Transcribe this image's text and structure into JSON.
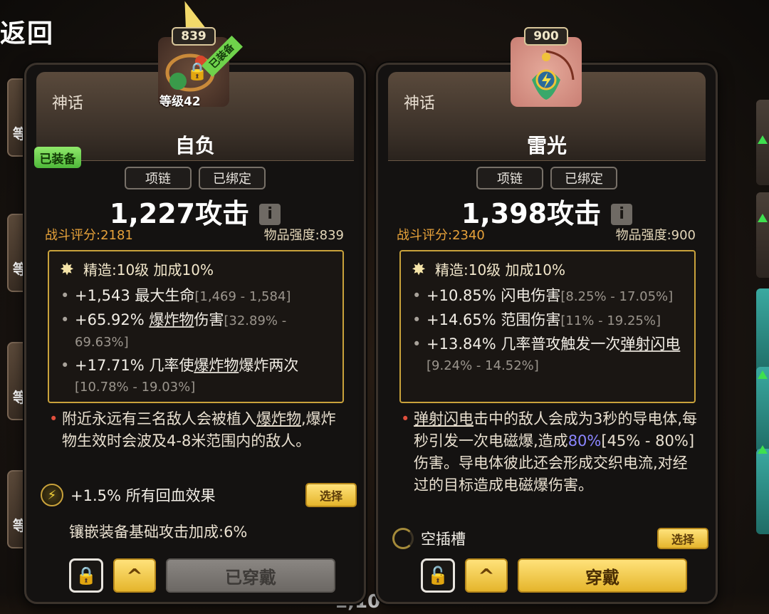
{
  "nav": {
    "back_label": "返回"
  },
  "background": {
    "bottom_text": "1,10"
  },
  "left_card": {
    "item_level": "839",
    "equipped_ribbon": "已装备",
    "thumb_level": "等级42",
    "equipped_badge": "已装备",
    "rarity": "神话",
    "name": "自负",
    "tags": [
      "项链",
      "已绑定"
    ],
    "attack": "1,227攻击",
    "combat_score": "战斗评分:2181",
    "item_power": "物品强度:839",
    "refine": "精造:10级 加成10%",
    "mods": [
      {
        "value": "+1,543 最大生命",
        "range": "[1,469 - 1,584]"
      },
      {
        "pre": "+65.92% ",
        "link": "爆炸物",
        "post": "伤害",
        "range": "[32.89% - 69.63%]"
      },
      {
        "pre": "+17.71% 几率使",
        "link": "爆炸物",
        "post": "爆炸两次",
        "range": "[10.78% - 19.03%]"
      }
    ],
    "unique_pre": "附近永远有三名敌人会被植入",
    "unique_link": "爆炸物",
    "unique_post": ",爆炸物生效时会波及4-8米范围内的敌人。",
    "gem_text": "+1.5% 所有回血效果",
    "select_label": "选择",
    "socket_bonus": "镶嵌装备基础攻击加成:6%",
    "up_label": "^",
    "main_button": "已穿戴"
  },
  "right_card": {
    "item_level": "900",
    "rarity": "神话",
    "name": "雷光",
    "tags": [
      "项链",
      "已绑定"
    ],
    "attack": "1,398攻击",
    "combat_score": "战斗评分:2340",
    "item_power": "物品强度:900",
    "refine": "精造:10级 加成10%",
    "mods": [
      {
        "value": "+10.85% 闪电伤害",
        "range": "[8.25% - 17.05%]"
      },
      {
        "value": "+14.65% 范围伤害",
        "range": "[11% - 19.25%]"
      },
      {
        "pre": "+13.84% 几率普攻触发一次",
        "link": "弹射闪电",
        "post": "",
        "range": "[9.24% - 14.52%]"
      }
    ],
    "unique_link": "弹射闪电",
    "unique_mid": "击中的敌人会成为3秒的导电体,每秒引发一次电磁爆,造成",
    "unique_hl": "80%",
    "unique_range": "[45% - 80%]",
    "unique_post": "伤害。导电体彼此还会形成交织电流,对经过的目标造成电磁爆伤害。",
    "empty_socket": "空插槽",
    "select_label": "选择",
    "up_label": "^",
    "main_button": "穿戴"
  },
  "colors": {
    "accent_gold": "#e5b52c",
    "score_orange": "#e7a23a",
    "frame_gold": "#c9a23b",
    "equipped_green": "#6fd24b",
    "highlight_blue": "#8b86ff"
  }
}
